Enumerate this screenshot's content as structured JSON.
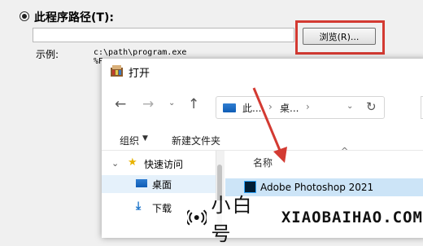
{
  "program_dialog": {
    "path_label": "此程序路径(T):",
    "browse_label": "浏览(R)...",
    "example_label": "示例:",
    "example_line1": "c:\\path\\program.exe",
    "example_line2": "%P"
  },
  "open_dialog": {
    "title": "打开",
    "breadcrumb": [
      "此...",
      "桌..."
    ],
    "toolbar": {
      "organize": "组织",
      "new_folder": "新建文件夹"
    },
    "column_name": "名称",
    "nav_items": [
      {
        "label": "快速访问",
        "icon": "star-icon"
      },
      {
        "label": "桌面",
        "icon": "desktop-icon"
      },
      {
        "label": "下载",
        "icon": "download-icon"
      }
    ],
    "files": [
      {
        "name": "Adobe Photoshop 2021",
        "icon": "photoshop-icon"
      }
    ]
  },
  "watermark": {
    "cn": "小白号",
    "en": "XIAOBAIHAO.COM"
  },
  "colors": {
    "highlight": "#d33a32",
    "selection": "#cce4f7",
    "accent": "#0f5cb5"
  }
}
